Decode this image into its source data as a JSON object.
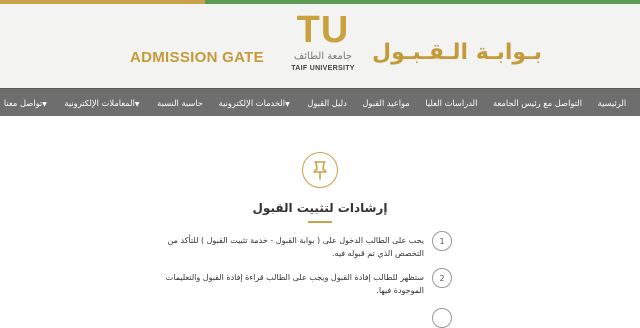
{
  "header": {
    "brand_en": "ADMISSION GATE",
    "brand_ar": "بـوابـة الـقـبـول",
    "logo_mark": "TU",
    "logo_ar": "جامعة الطائف",
    "logo_en": "TAIF UNIVERSITY",
    "accent_color": "#c9a24a"
  },
  "nav": {
    "items": [
      {
        "label": "الرئيسية"
      },
      {
        "label": "التواصل مع رئيس الجامعة"
      },
      {
        "label": "الدراسات العليا"
      },
      {
        "label": "مواعيد القبول"
      },
      {
        "label": "دليل القبول"
      },
      {
        "label": "الخدمات الإلكترونية",
        "dropdown": true
      },
      {
        "label": "حاسبة النسبة"
      },
      {
        "label": "المعاملات الإلكترونية",
        "dropdown": true
      },
      {
        "label": "تواصل معنا",
        "dropdown": true
      }
    ]
  },
  "main": {
    "icon": "pushpin-icon",
    "title": "إرشادات لتثبيت القبول",
    "steps": [
      {
        "num": "1",
        "text": "يجب على الطالب الدخول على ( بوابة القبول - خدمة تثبيت القبول ) للتأكد من التخصص الذي تم قبوله فيه."
      },
      {
        "num": "2",
        "text": "ستظهر للطالب إفادة القبول ويجب على الطالب قراءة إفادة القبول والتعليمات الموجودة فيها."
      }
    ]
  }
}
